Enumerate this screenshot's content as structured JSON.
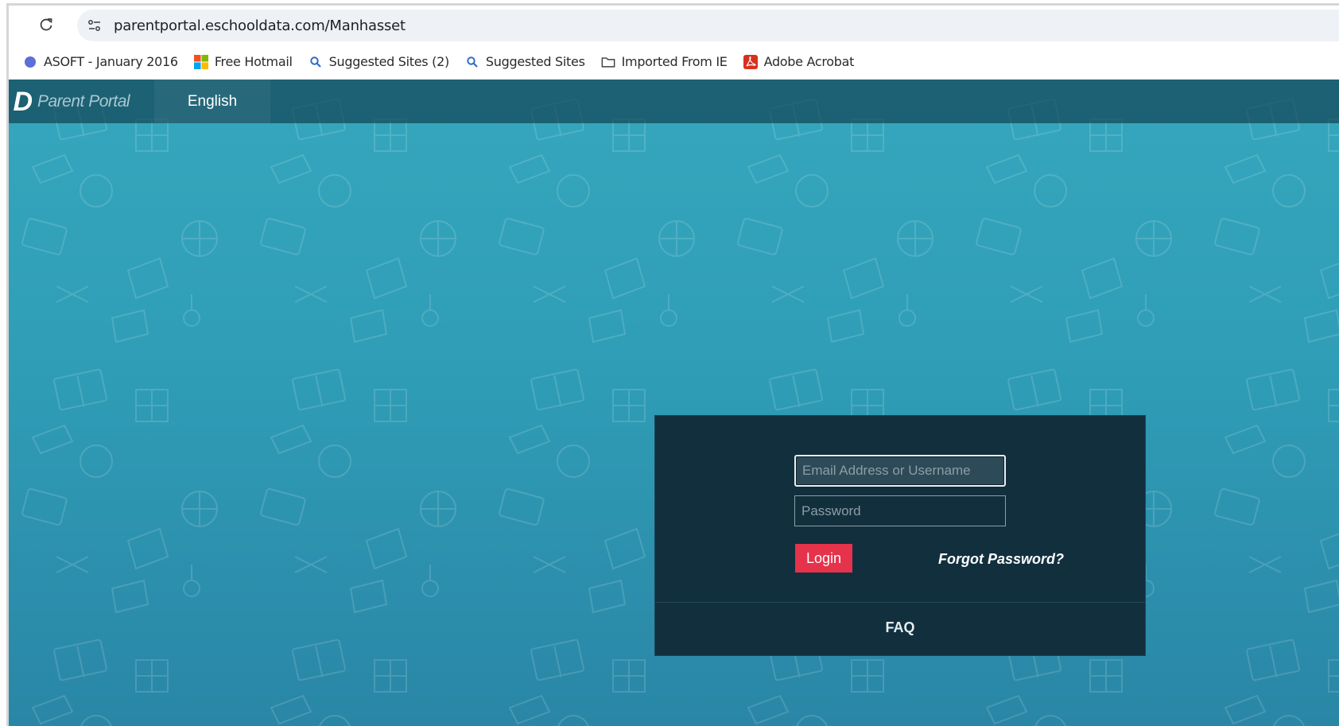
{
  "browser": {
    "url": "parentportal.eschooldata.com/Manhasset",
    "bookmarks": [
      {
        "label": "ASOFT - January 2016",
        "icon": "globe-icon"
      },
      {
        "label": "Free Hotmail",
        "icon": "windows-icon"
      },
      {
        "label": "Suggested Sites (2)",
        "icon": "search-icon"
      },
      {
        "label": "Suggested Sites",
        "icon": "search-icon"
      },
      {
        "label": "Imported From IE",
        "icon": "folder-icon"
      },
      {
        "label": "Adobe Acrobat",
        "icon": "acrobat-icon"
      }
    ]
  },
  "header": {
    "logo_mark": "D",
    "logo_text": "Parent Portal",
    "language": "English"
  },
  "login": {
    "email_placeholder": "Email Address or Username",
    "password_placeholder": "Password",
    "login_label": "Login",
    "forgot_label": "Forgot Password?",
    "faq_label": "FAQ"
  },
  "colors": {
    "accent_red": "#e5334b",
    "panel_bg": "#122f3e",
    "nav_bg": "#1e5366",
    "page_bg": "#2f9db6"
  }
}
